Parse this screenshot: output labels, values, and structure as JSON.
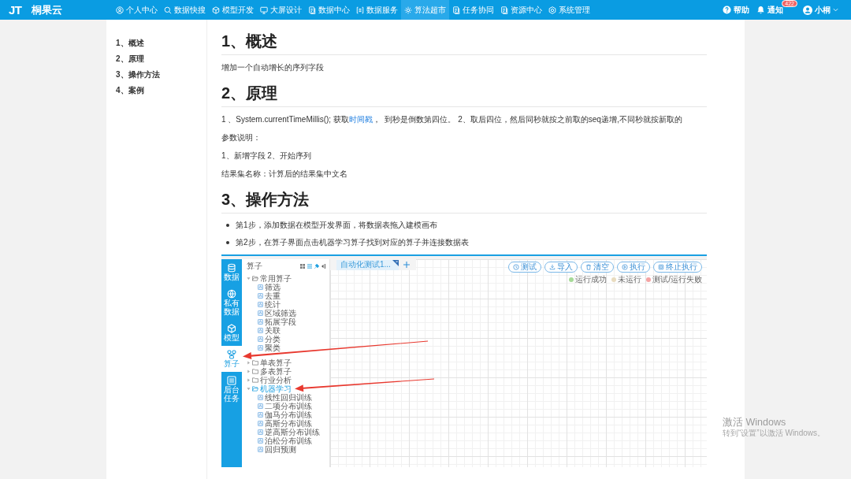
{
  "nav": {
    "logo": "JT",
    "brand": "桐果云",
    "items": [
      {
        "label": "个人中心",
        "selected": false
      },
      {
        "label": "数据快搜",
        "selected": false
      },
      {
        "label": "模型开发",
        "selected": false
      },
      {
        "label": "大屏设计",
        "selected": false
      },
      {
        "label": "数据中心",
        "selected": false
      },
      {
        "label": "数据服务",
        "selected": false
      },
      {
        "label": "算法超市",
        "selected": true
      },
      {
        "label": "任务协同",
        "selected": false
      },
      {
        "label": "资源中心",
        "selected": false
      },
      {
        "label": "系统管理",
        "selected": false
      }
    ],
    "help": "帮助",
    "notice": {
      "label": "通知",
      "badge": "422"
    },
    "user": "小桐"
  },
  "toc": [
    {
      "label": "1、概述"
    },
    {
      "label": "2、原理"
    },
    {
      "label": "3、操作方法"
    },
    {
      "label": "4、案例"
    }
  ],
  "sections": [
    {
      "heading": "1、概述",
      "blocks": [
        {
          "kind": "paragraph",
          "text": "增加一个自动增长的序列字段"
        }
      ]
    },
    {
      "heading": "2、原理",
      "blocks": [
        {
          "kind": "linked",
          "before": "1 、System.currentTimeMillis(); 获取",
          "link": "时间戳",
          "after": "，  到秒是倒数第四位。 2、取后四位，然后同秒就按之前取的seq递增,不同秒就按新取的"
        },
        {
          "kind": "paragraph",
          "text": "参数说明："
        },
        {
          "kind": "paragraph",
          "text": "1、新增字段 2、开始序列"
        },
        {
          "kind": "paragraph",
          "text": "结果集名称：计算后的结果集中文名"
        }
      ]
    },
    {
      "heading": "3、操作方法",
      "blocks": [
        {
          "kind": "bullet",
          "text": "第1步，添加数据在模型开发界面，将数据表拖入建模画布"
        },
        {
          "kind": "bullet",
          "text": "第2步，在算子界面点击机器学习算子找到对应的算子并连接数据表"
        },
        {
          "kind": "screenshot",
          "rail": [
            {
              "label": "数据",
              "selected": false
            },
            {
              "label": "私有数据",
              "selected": false
            },
            {
              "label": "模型",
              "selected": false
            },
            {
              "label": "算子",
              "selected": true
            },
            {
              "label": "后台任务",
              "selected": false
            }
          ],
          "panel_title": "算子",
          "tree": [
            {
              "label": "常用算子",
              "expanded": true,
              "selected": false,
              "children": [
                {
                  "label": "筛选",
                  "selected": false
                },
                {
                  "label": "去重",
                  "selected": false
                },
                {
                  "label": "统计",
                  "selected": false
                },
                {
                  "label": "区域筛选",
                  "selected": false
                },
                {
                  "label": "拓展字段",
                  "selected": false
                },
                {
                  "label": "关联",
                  "selected": false
                },
                {
                  "label": "分类",
                  "selected": false
                },
                {
                  "label": "聚类",
                  "selected": false
                }
              ]
            },
            {
              "label": "单表算子",
              "expanded": false,
              "selected": false
            },
            {
              "label": "多表算子",
              "expanded": false,
              "selected": false
            },
            {
              "label": "行业分析",
              "expanded": false,
              "selected": false
            },
            {
              "label": "机器学习",
              "expanded": true,
              "selected": true,
              "children": [
                {
                  "label": "线性回归训练",
                  "selected": false
                },
                {
                  "label": "二项分布训练",
                  "selected": false
                },
                {
                  "label": "伽马分布训练",
                  "selected": false
                },
                {
                  "label": "高斯分布训练",
                  "selected": false
                },
                {
                  "label": "逆高斯分布训练",
                  "selected": false
                },
                {
                  "label": "泊松分布训练",
                  "selected": false
                },
                {
                  "label": "回归预测",
                  "selected": false
                }
              ]
            }
          ],
          "tabs": [
            {
              "label": "自动化测试1...",
              "selected": true
            }
          ],
          "toolbar": [
            "测试",
            "导入",
            "清空",
            "执行",
            "终止执行"
          ],
          "legend": [
            {
              "label": "运行成功",
              "color": "#a6da98"
            },
            {
              "label": "未运行",
              "color": "#e9dcbf"
            },
            {
              "label": "测试/运行失败",
              "color": "#f5a3a3"
            }
          ]
        }
      ]
    }
  ],
  "os_notice": {
    "title": "激活 Windows",
    "hint": "转到“设置”以激活 Windows。"
  }
}
